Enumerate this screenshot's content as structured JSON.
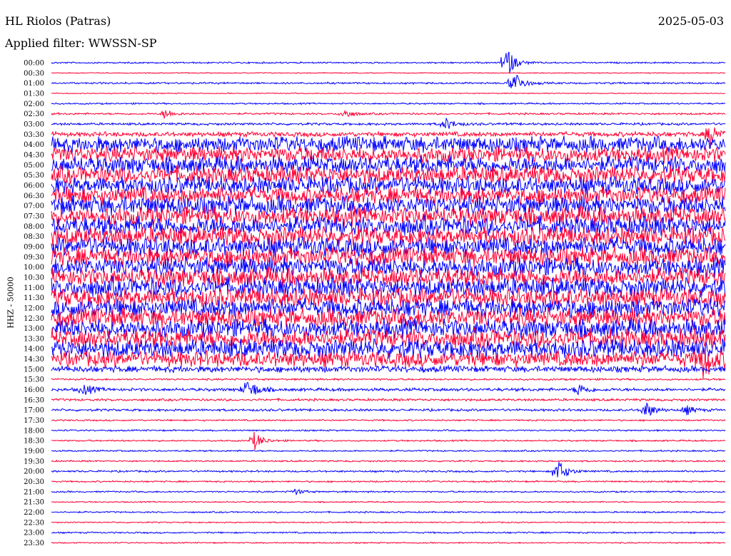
{
  "header": {
    "station": "HL Riolos (Patras)",
    "date": "2025-05-03",
    "filter": "Applied filter: WWSSN-SP"
  },
  "chart_data": {
    "type": "line",
    "title": "HL Riolos (Patras)",
    "ylabel": "HHZ - 50000",
    "xlabel": "",
    "row_labels": [
      "00:00",
      "00:30",
      "01:00",
      "01:30",
      "02:00",
      "02:30",
      "03:00",
      "03:30",
      "04:00",
      "04:30",
      "05:00",
      "05:30",
      "06:00",
      "06:30",
      "07:00",
      "07:30",
      "08:00",
      "08:30",
      "09:00",
      "09:30",
      "10:00",
      "10:30",
      "11:00",
      "11:30",
      "12:00",
      "12:30",
      "13:00",
      "13:30",
      "14:00",
      "14:30",
      "15:00",
      "15:30",
      "16:00",
      "16:30",
      "17:00",
      "17:30",
      "18:00",
      "18:30",
      "19:00",
      "19:30",
      "20:00",
      "20:30",
      "21:00",
      "21:30",
      "22:00",
      "22:30",
      "23:00",
      "23:30"
    ],
    "row_minutes": 30,
    "colors": [
      "#0000ff",
      "#ff0033"
    ],
    "relative_noise_amplitude": [
      1,
      0.6,
      1.2,
      0.6,
      1,
      1.2,
      1.5,
      3,
      10,
      10,
      11,
      11,
      11,
      11,
      12,
      12,
      12,
      12,
      12,
      12,
      12,
      12,
      12,
      12,
      12,
      12,
      12,
      12,
      12,
      10,
      4,
      1.2,
      2,
      1.5,
      1.5,
      1,
      1,
      1,
      1,
      1,
      1.2,
      1,
      1,
      0.8,
      1,
      0.8,
      1,
      0.8
    ],
    "events": [
      {
        "row": 0,
        "minute": 20.2,
        "amp": 26
      },
      {
        "row": 2,
        "minute": 20.5,
        "amp": 24
      },
      {
        "row": 5,
        "minute": 5,
        "amp": 8
      },
      {
        "row": 5,
        "minute": 13,
        "amp": 8
      },
      {
        "row": 6,
        "minute": 17.5,
        "amp": 10
      },
      {
        "row": 7,
        "minute": 29.3,
        "amp": 20
      },
      {
        "row": 29,
        "minute": 29,
        "amp": 25
      },
      {
        "row": 32,
        "minute": 1.4,
        "amp": 10
      },
      {
        "row": 32,
        "minute": 8.8,
        "amp": 10
      },
      {
        "row": 32,
        "minute": 8.6,
        "amp": 9
      },
      {
        "row": 32,
        "minute": 23.4,
        "amp": 10
      },
      {
        "row": 34,
        "minute": 26.4,
        "amp": 14
      },
      {
        "row": 34,
        "minute": 28.2,
        "amp": 8
      },
      {
        "row": 37,
        "minute": 9,
        "amp": 14
      },
      {
        "row": 40,
        "minute": 22.5,
        "amp": 20
      },
      {
        "row": 42,
        "minute": 10.8,
        "amp": 5
      }
    ]
  }
}
